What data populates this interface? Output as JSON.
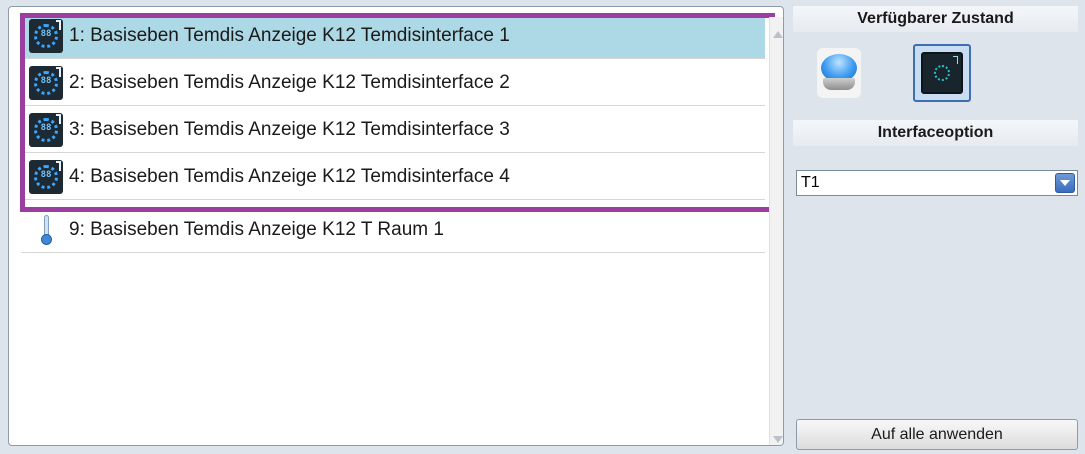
{
  "list": {
    "items": [
      {
        "label": "1: Basiseben Temdis Anzeige K12 Temdisinterface 1",
        "icon": "temdis-display-icon",
        "selected": true
      },
      {
        "label": "2: Basiseben Temdis Anzeige K12 Temdisinterface 2",
        "icon": "temdis-display-icon",
        "selected": false
      },
      {
        "label": "3: Basiseben Temdis Anzeige K12 Temdisinterface 3",
        "icon": "temdis-display-icon",
        "selected": false
      },
      {
        "label": "4: Basiseben Temdis Anzeige K12 Temdisinterface 4",
        "icon": "temdis-display-icon",
        "selected": false
      },
      {
        "label": "9: Basiseben Temdis Anzeige K12 T Raum 1",
        "icon": "thermometer-icon",
        "selected": false
      }
    ],
    "icon_digits": "88",
    "selection_color": "#add8e6",
    "highlight_color": "#9a3fa0"
  },
  "right_panel": {
    "state_header": "Verfügbarer Zustand",
    "state_options": [
      {
        "icon": "blue-pushbutton-icon",
        "selected": false
      },
      {
        "icon": "temdis-display-icon",
        "selected": true
      }
    ],
    "interface_header": "Interfaceoption",
    "interface_select": {
      "value": "T1",
      "icon": "dropdown-arrow-icon"
    },
    "apply_button": "Auf alle anwenden"
  }
}
